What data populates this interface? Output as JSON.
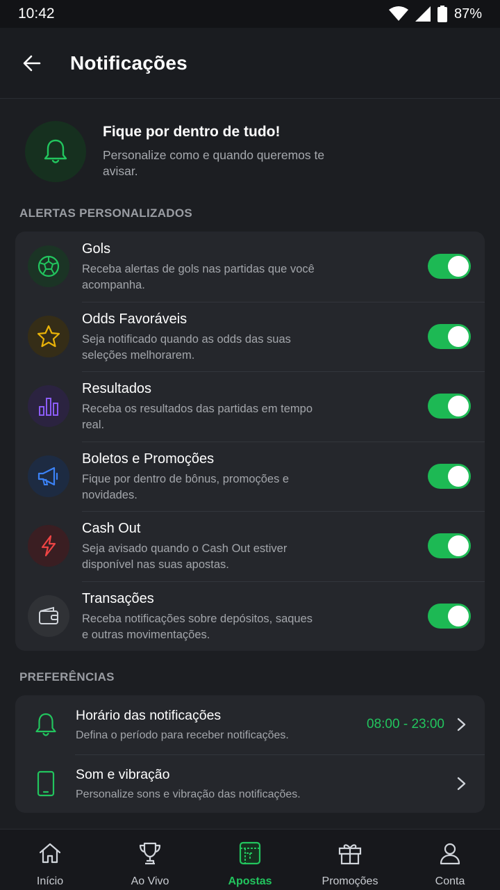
{
  "status_bar": {
    "time": "10:42",
    "battery": "87%"
  },
  "header": {
    "title": "Notificações"
  },
  "hero": {
    "title": "Fique por dentro de tudo!",
    "subtitle": "Personalize como e quando queremos te avisar."
  },
  "alerts_section": {
    "label": "ALERTAS PERSONALIZADOS",
    "items": [
      {
        "icon": "soccer-ball-icon",
        "title": "Gols",
        "description": "Receba alertas de gols nas partidas que você acompanha.",
        "enabled": true,
        "accent": "#22c55e"
      },
      {
        "icon": "star-icon",
        "title": "Odds Favoráveis",
        "description": "Seja notificado quando as odds das suas seleções melhorarem.",
        "enabled": true,
        "accent": "#eab308"
      },
      {
        "icon": "bar-chart-icon",
        "title": "Resultados",
        "description": "Receba os resultados das partidas em tempo real.",
        "enabled": true,
        "accent": "#8b5cf6"
      },
      {
        "icon": "megaphone-icon",
        "title": "Boletos e Promoções",
        "description": "Fique por dentro de bônus, promoções e novidades.",
        "enabled": true,
        "accent": "#3b82f6"
      },
      {
        "icon": "lightning-icon",
        "title": "Cash Out",
        "description": "Seja avisado quando o Cash Out estiver disponível nas suas apostas.",
        "enabled": true,
        "accent": "#ef4444"
      },
      {
        "icon": "wallet-icon",
        "title": "Transações",
        "description": "Receba notificações sobre depósitos, saques e outras movimentações.",
        "enabled": true,
        "accent": "#d1d5db"
      }
    ]
  },
  "preferences_section": {
    "label": "PREFERÊNCIAS",
    "items": [
      {
        "icon": "bell-icon",
        "title": "Horário das notificações",
        "description": "Defina o período para receber notificações.",
        "value": "08:00 - 23:00"
      },
      {
        "icon": "phone-icon",
        "title": "Som e vibração",
        "description": "Personalize sons e vibração das notificações.",
        "value": ""
      }
    ]
  },
  "bottom_nav": {
    "items": [
      {
        "icon": "home-icon",
        "label": "Início",
        "active": false
      },
      {
        "icon": "trophy-icon",
        "label": "Ao Vivo",
        "active": false
      },
      {
        "icon": "ticket-icon",
        "label": "Apostas",
        "active": true
      },
      {
        "icon": "gift-icon",
        "label": "Promoções",
        "active": false
      },
      {
        "icon": "user-icon",
        "label": "Conta",
        "active": false
      }
    ]
  },
  "colors": {
    "accent": "#22c55e",
    "background": "#1c1e22",
    "card": "#25272c"
  }
}
